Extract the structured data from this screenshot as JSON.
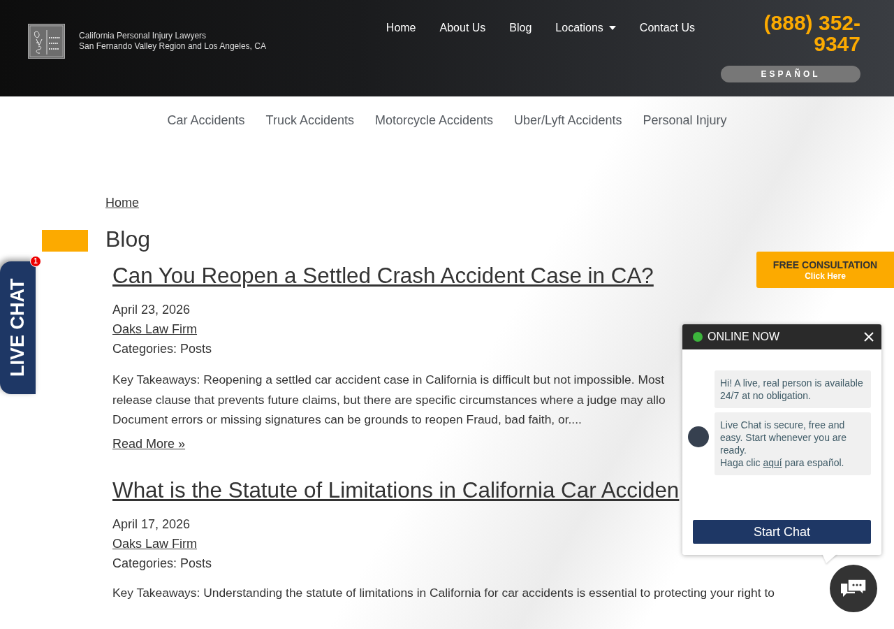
{
  "header": {
    "tagline": "California Personal Injury Lawyers",
    "region": "San Fernando Valley Region and Los Angeles, CA",
    "nav": [
      {
        "label": "Home",
        "kind": "link"
      },
      {
        "label": "About Us",
        "kind": "link"
      },
      {
        "label": "Blog",
        "kind": "link"
      },
      {
        "label": "Locations",
        "kind": "dropdown"
      },
      {
        "label": "Contact Us",
        "kind": "link"
      }
    ],
    "phone": "(888) 352-9347",
    "language_button": "ESPAÑOL"
  },
  "practice_nav": [
    "Car Accidents",
    "Truck Accidents",
    "Motorcycle Accidents",
    "Uber/Lyft Accidents",
    "Personal Injury"
  ],
  "breadcrumb": "Home",
  "page_title": "Blog",
  "posts": [
    {
      "title": "Can You Reopen a Settled Crash Accident Case in CA?",
      "date": "April 23, 2026",
      "author": "Oaks Law Firm",
      "categories": "Categories: Posts",
      "excerpt_lines": [
        "Key Takeaways: Reopening a settled car accident case in California is difficult but not impossible. Most",
        "release clause that prevents future claims, but there are specific circumstances where a judge may allo",
        "Document errors or missing signatures can be grounds to reopen Fraud, bad faith, or...."
      ],
      "read_more": "Read More »"
    },
    {
      "title": "What is the Statute of Limitations in California Car Acciden",
      "date": "April 17, 2026",
      "author": "Oaks Law Firm",
      "categories": "Categories: Posts",
      "excerpt_lines": [
        "Key Takeaways: Understanding the statute of limitations in California for car accidents is essential to protecting your right to"
      ]
    }
  ],
  "live_chat_tab": {
    "label": "LIVE CHAT",
    "badge": "1"
  },
  "consultation": {
    "title": "FREE CONSULTATION",
    "subtitle": "Click Here"
  },
  "chat_popup": {
    "status": "ONLINE NOW",
    "online": true,
    "greeting": "Hi! A live, real person is available 24/7 at no obligation.",
    "message": "Live Chat is secure, free and easy. Start whenever you are ready.",
    "spanish": {
      "before": "Haga clic",
      "link": "aquí",
      "after": "para español."
    },
    "button": "Start Chat"
  }
}
